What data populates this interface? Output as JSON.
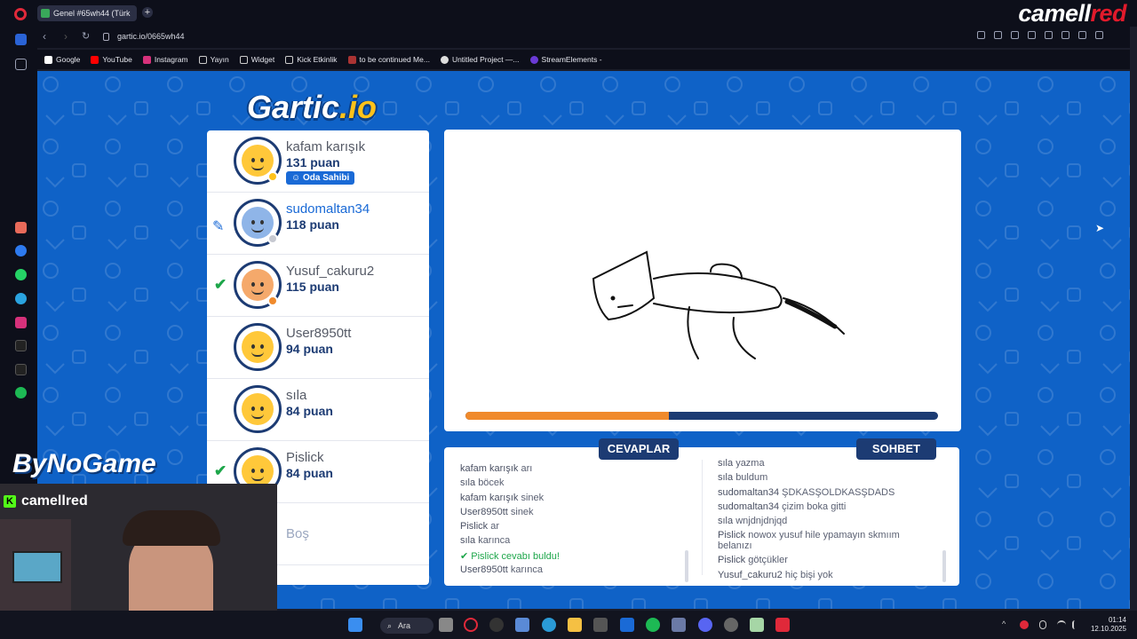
{
  "browser": {
    "tab_title": "Genel #65wh44 (Türk",
    "new_tab_label": "+",
    "url": "gartic.io/0665wh44",
    "brand_part1": "camell",
    "brand_part2": "red",
    "bookmarks": [
      "Google",
      "YouTube",
      "Instagram",
      "Yayın",
      "Widget",
      "Kick Etkinlik",
      "to be continued Me...",
      "Untitled Project —...",
      "StreamElements -"
    ]
  },
  "game": {
    "logo_main": "Gartic",
    "logo_suffix": ".io",
    "players": [
      {
        "name": "kafam karışık",
        "score": "131 puan",
        "badge": "Oda Sahibi",
        "status_color": "#ffc21a",
        "drawing": false,
        "guessed": false
      },
      {
        "name": "sudomaltan34",
        "score": "118 puan",
        "badge": "",
        "status_color": "#c7c9d1",
        "drawing": true,
        "guessed": false
      },
      {
        "name": "Yusuf_cakuru2",
        "score": "115 puan",
        "badge": "",
        "status_color": "#f08a2c",
        "drawing": false,
        "guessed": true
      },
      {
        "name": "User8950tt",
        "score": "94 puan",
        "badge": "",
        "status_color": "",
        "drawing": false,
        "guessed": false
      },
      {
        "name": "sıla",
        "score": "84 puan",
        "badge": "",
        "status_color": "",
        "drawing": false,
        "guessed": false
      },
      {
        "name": "Pislick",
        "score": "84 puan",
        "badge": "",
        "status_color": "",
        "drawing": false,
        "guessed": true
      }
    ],
    "empty_slot": "Boş",
    "timer_progress": 0.43,
    "answers_label": "CEVAPLAR",
    "chat_label": "SOHBET",
    "answers": [
      {
        "user": "kafam karışık",
        "text": "arı"
      },
      {
        "user": "sıla",
        "text": "böcek"
      },
      {
        "user": "kafam karışık",
        "text": "sinek"
      },
      {
        "user": "User8950tt",
        "text": "sinek"
      },
      {
        "user": "Pislick",
        "text": "ar"
      },
      {
        "user": "sıla",
        "text": "karınca"
      },
      {
        "user": "✔ Pislick",
        "text": "cevabı buldu!",
        "system": true
      },
      {
        "user": "User8950tt",
        "text": "karınca"
      }
    ],
    "chat": [
      {
        "user": "sıla",
        "text": "yazma"
      },
      {
        "user": "sıla",
        "text": "buldum"
      },
      {
        "user": "sudomaltan34",
        "text": "ŞDKASŞOLDKASŞDADS"
      },
      {
        "user": "sudomaltan34",
        "text": "çizim boka gitti"
      },
      {
        "user": "sıla",
        "text": "wnjdnjdnjqd"
      },
      {
        "user": "Pislick",
        "text": "nowox yusuf hile ypamayın skmıım belanızı"
      },
      {
        "user": "Pislick",
        "text": "götçükler"
      },
      {
        "user": "Yusuf_cakuru2",
        "text": "hiç bişi yok"
      }
    ]
  },
  "stream": {
    "overlay_brand": "ByNoGame",
    "kick_user": "camellred",
    "kick_letter": "K"
  },
  "taskbar": {
    "search_label": "Ara",
    "time": "01:14",
    "date": "12.10.2025"
  }
}
